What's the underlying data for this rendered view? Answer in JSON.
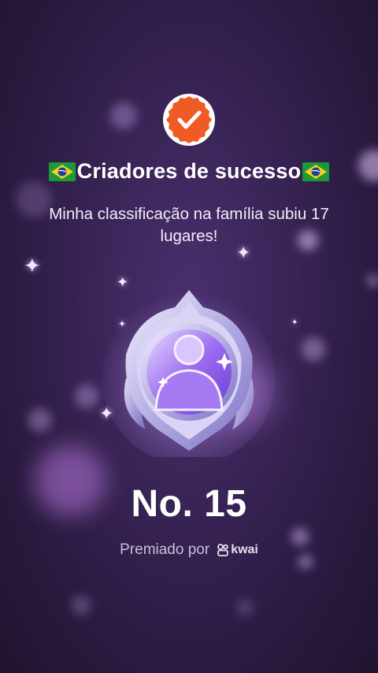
{
  "header": {
    "badge_icon": "verified-check-icon",
    "title_prefix_flag": "brazil-flag-icon",
    "title": "Criadores de sucesso",
    "title_suffix_flag": "brazil-flag-icon",
    "subtitle": "Minha classificação na família subiu 17 lugares!"
  },
  "medal": {
    "icon": "rank-medal-icon"
  },
  "rank": {
    "label": "No. 15"
  },
  "footer": {
    "awarded_by": "Premiado por",
    "brand": "kwai",
    "brand_icon": "kwai-logo-icon"
  },
  "colors": {
    "badge_orange": "#f05a24",
    "background": "#3a2558",
    "accent_purple": "#b48cff"
  }
}
